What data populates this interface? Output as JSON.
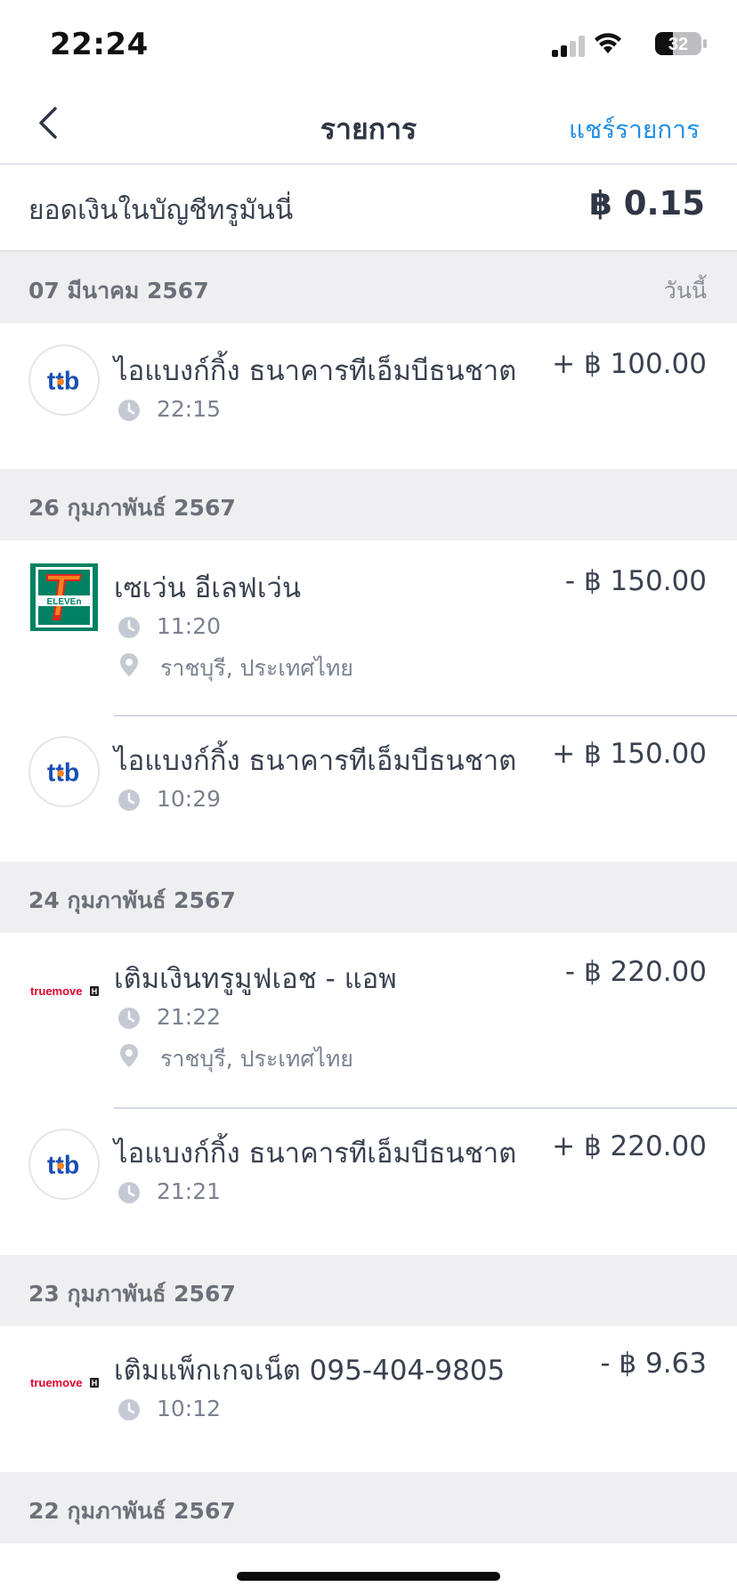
{
  "status_bar": {
    "time": "22:24",
    "battery": "32"
  },
  "nav": {
    "title": "รายการ",
    "share_label": "แชร์รายการ"
  },
  "balance": {
    "label": "ยอดเงินในบัญชีทรูมันนี่",
    "value": "฿ 0.15"
  },
  "groups": [
    {
      "date": "07 มีนาคม 2567",
      "today_label": "วันนี้",
      "transactions": [
        {
          "logo": "ttb-logo",
          "title": "ไอแบงก์กิ้ง ธนาคารทีเอ็มบีธนชาต",
          "amount": "+ ฿ 100.00",
          "time": "22:15"
        }
      ]
    },
    {
      "date": "26 กุมภาพันธ์ 2567",
      "transactions": [
        {
          "logo": "7-eleven-logo",
          "title": "เซเว่น อีเลฟเว่น",
          "amount": "- ฿ 150.00",
          "time": "11:20",
          "location": "ราชบุรี, ประเทศไทย"
        },
        {
          "logo": "ttb-logo",
          "title": "ไอแบงก์กิ้ง ธนาคารทีเอ็มบีธนชาต",
          "amount": "+ ฿ 150.00",
          "time": "10:29"
        }
      ]
    },
    {
      "date": "24 กุมภาพันธ์ 2567",
      "transactions": [
        {
          "logo": "truemove-logo",
          "title": "เติมเงินทรูมูฟเอช - แอพ",
          "amount": "- ฿ 220.00",
          "time": "21:22",
          "location": "ราชบุรี, ประเทศไทย"
        },
        {
          "logo": "ttb-logo",
          "title": "ไอแบงก์กิ้ง ธนาคารทีเอ็มบีธนชาต",
          "amount": "+ ฿ 220.00",
          "time": "21:21"
        }
      ]
    },
    {
      "date": "23 กุมภาพันธ์ 2567",
      "transactions": [
        {
          "logo": "truemove-logo",
          "title": "เติมแพ็กเกจเน็ต 095-404-9805",
          "amount": "- ฿ 9.63",
          "time": "10:12"
        }
      ]
    },
    {
      "date": "22 กุมภาพันธ์ 2567",
      "transactions": []
    }
  ],
  "logos": {
    "ttb": "ttb",
    "seven_eleven": "ELEVEn",
    "truemove": "truemove"
  },
  "colors": {
    "accent": "#1f8ee6",
    "ttb_blue": "#1a4fb5",
    "ttb_orange": "#f5821f",
    "seven_green": "#008163",
    "seven_red": "#e0261b",
    "seven_orange": "#f58220",
    "truemove_red": "#e4002b"
  }
}
